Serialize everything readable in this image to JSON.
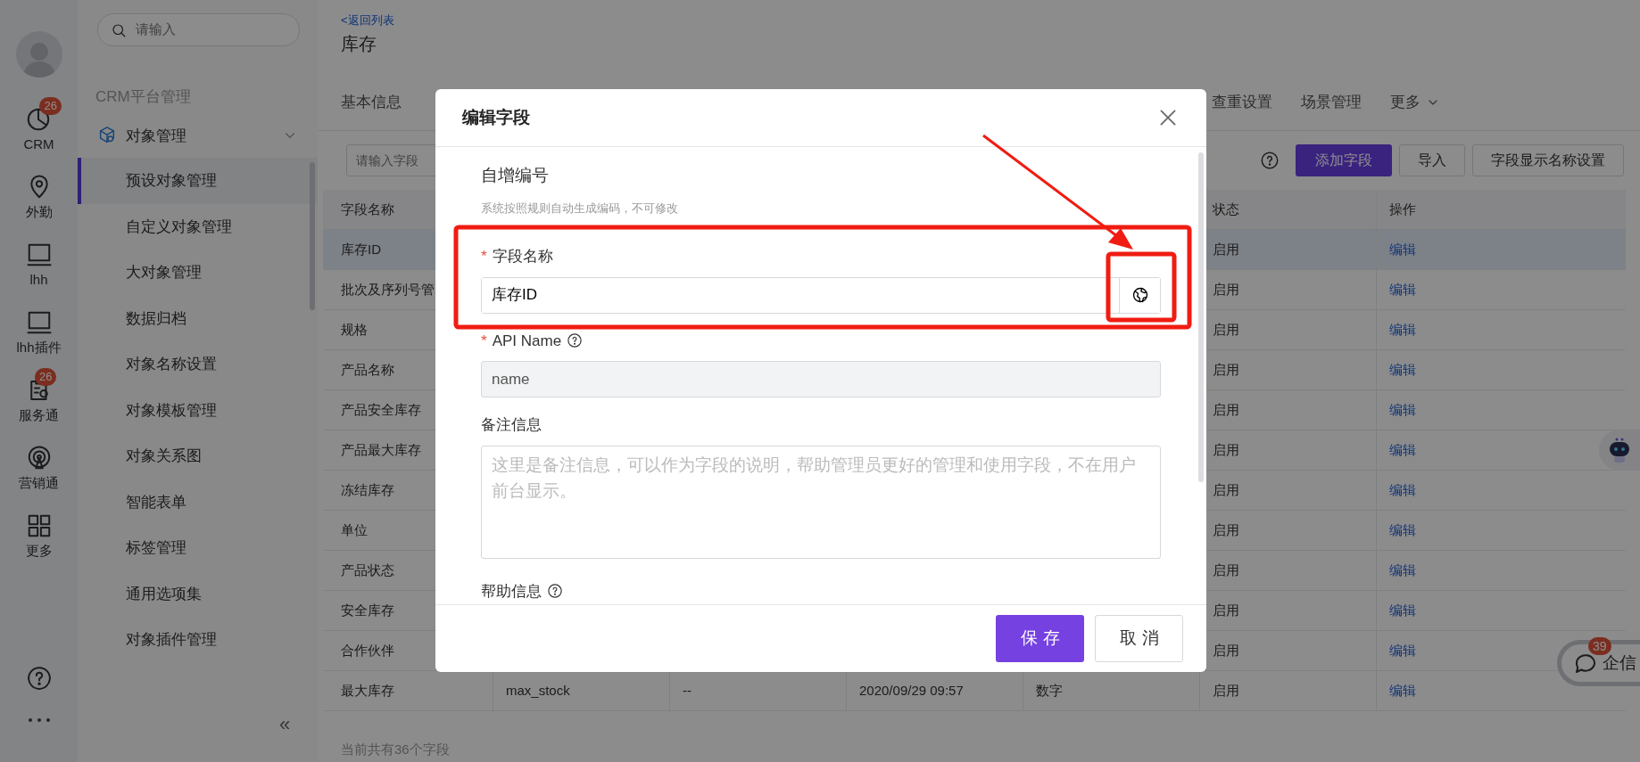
{
  "rail": {
    "items": [
      {
        "label": "CRM",
        "kind": "pie",
        "badge": "26"
      },
      {
        "label": "外勤",
        "kind": "pin"
      },
      {
        "label": "lhh",
        "kind": "monitor"
      },
      {
        "label": "lhh插件",
        "kind": "monitor"
      },
      {
        "label": "服务通",
        "kind": "service",
        "badge": "26"
      },
      {
        "label": "营销通",
        "kind": "broadcast"
      },
      {
        "label": "更多",
        "kind": "grid"
      }
    ]
  },
  "sidebar": {
    "search_placeholder": "请输入",
    "collapse": "«",
    "group": "CRM平台管理",
    "section": {
      "label": "对象管理",
      "expanded": true
    },
    "items": [
      {
        "label": "预设对象管理",
        "selected": true
      },
      {
        "label": "自定义对象管理",
        "selected": false
      },
      {
        "label": "大对象管理",
        "selected": false
      },
      {
        "label": "数据归档",
        "selected": false
      },
      {
        "label": "对象名称设置",
        "selected": false
      },
      {
        "label": "对象模板管理",
        "selected": false
      },
      {
        "label": "对象关系图",
        "selected": false
      },
      {
        "label": "智能表单",
        "selected": false
      },
      {
        "label": "标签管理",
        "selected": false
      },
      {
        "label": "通用选项集",
        "selected": false
      },
      {
        "label": "对象插件管理",
        "selected": false
      }
    ]
  },
  "header": {
    "back_link": "<返回列表",
    "title": "库存"
  },
  "tabs": [
    {
      "label": "基本信息"
    },
    {
      "label": "查重设置"
    },
    {
      "label": "场景管理"
    },
    {
      "label": "更多",
      "dropdown": true
    }
  ],
  "toolbar": {
    "search_placeholder": "请输入字段",
    "buttons": [
      {
        "label": "添加字段",
        "kind": "primary"
      },
      {
        "label": "导入",
        "kind": "default"
      },
      {
        "label": "字段显示名称设置",
        "kind": "default"
      }
    ]
  },
  "table": {
    "columns": {
      "field_name": "字段名称",
      "status": "状态",
      "action": "操作"
    },
    "rows": [
      {
        "field_name": "库存ID",
        "status": "启用",
        "action": "编辑",
        "selected": true
      },
      {
        "field_name": "批次及序列号管",
        "status": "启用",
        "action": "编辑",
        "selected": false
      },
      {
        "field_name": "规格",
        "status": "启用",
        "action": "编辑",
        "selected": false
      },
      {
        "field_name": "产品名称",
        "status": "启用",
        "action": "编辑",
        "selected": false
      },
      {
        "field_name": "产品安全库存",
        "status": "启用",
        "action": "编辑",
        "selected": false
      },
      {
        "field_name": "产品最大库存",
        "status": "启用",
        "action": "编辑",
        "selected": false
      },
      {
        "field_name": "冻结库存",
        "status": "启用",
        "action": "编辑",
        "selected": false
      },
      {
        "field_name": "单位",
        "status": "启用",
        "action": "编辑",
        "selected": false
      },
      {
        "field_name": "产品状态",
        "status": "启用",
        "action": "编辑",
        "selected": false
      },
      {
        "field_name": "安全库存",
        "status": "启用",
        "action": "编辑",
        "selected": false
      },
      {
        "field_name": "合作伙伴",
        "status": "启用",
        "action": "编辑",
        "selected": false
      },
      {
        "field_name": "最大库存",
        "column_2": "max_stock",
        "column_3": "--",
        "column_4": "2020/09/29 09:57",
        "column_5": "数字",
        "status": "启用",
        "action": "编辑",
        "selected": false
      }
    ],
    "footer": "当前共有36个字段"
  },
  "modal": {
    "title": "编辑字段",
    "section_title": "自增编号",
    "description": "系统按照规则自动生成编码，不可修改",
    "fields": [
      {
        "kind": "text",
        "required_mark": "*",
        "label": "字段名称",
        "value": "库存ID",
        "disabled": false,
        "globe_button": true
      },
      {
        "kind": "text",
        "required_mark": "*",
        "label": "API Name",
        "help": true,
        "value": "name",
        "disabled": true
      },
      {
        "kind": "textarea",
        "label": "备注信息",
        "placeholder": "这里是备注信息，可以作为字段的说明，帮助管理员更好的管理和使用字段，不在用户前台显示。"
      },
      {
        "kind": "label",
        "label": "帮助信息",
        "help": true
      }
    ],
    "buttons": [
      {
        "label": "保存",
        "kind": "primary"
      },
      {
        "label": "取消",
        "kind": "default"
      }
    ]
  },
  "chat": {
    "label": "企信",
    "badge": "39"
  }
}
